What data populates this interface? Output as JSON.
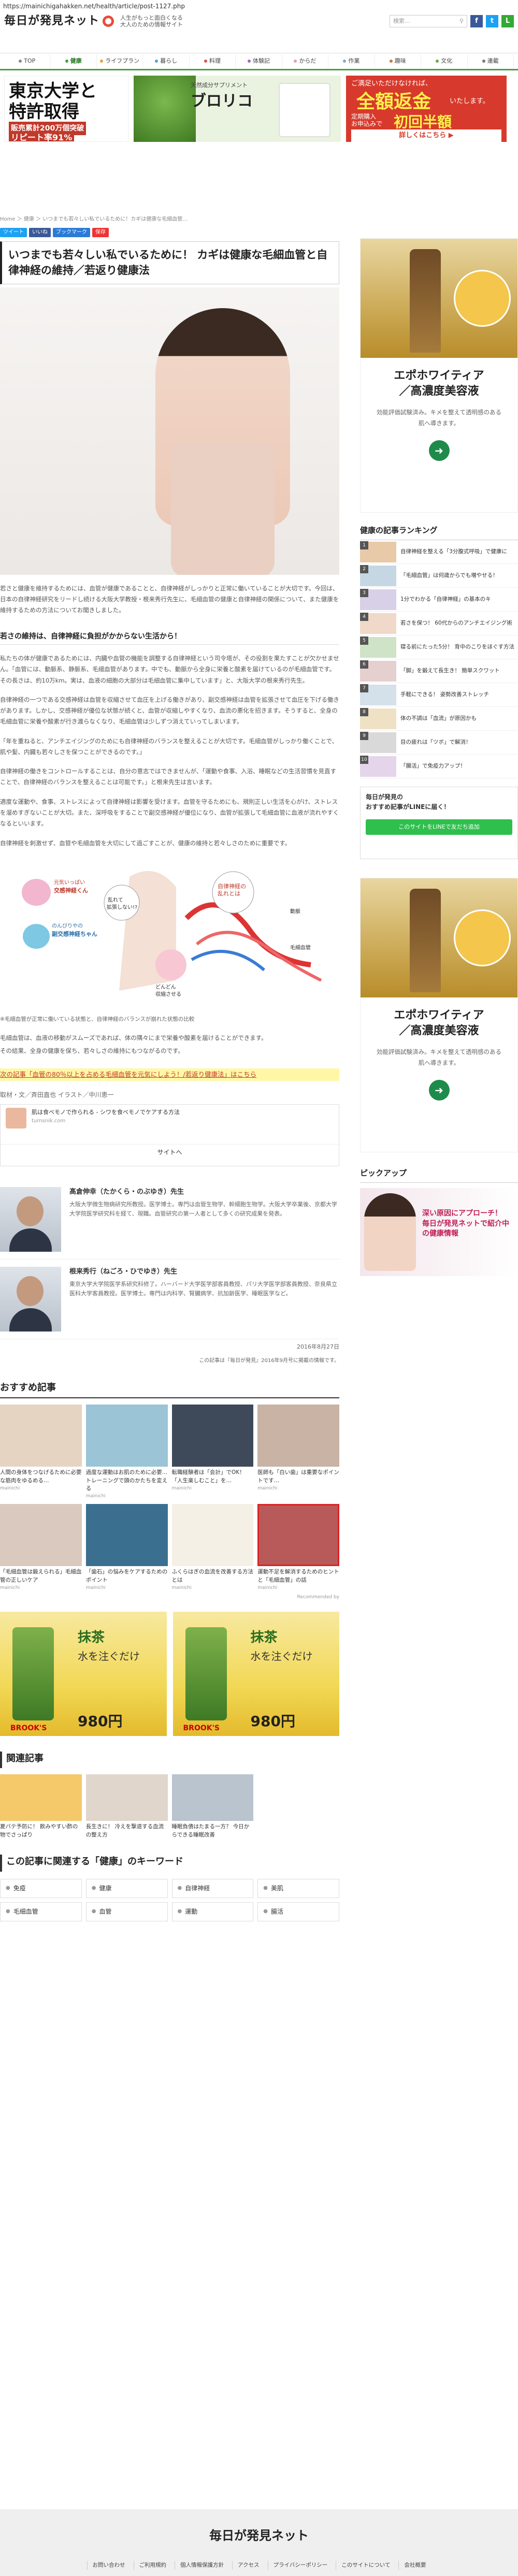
{
  "url": "https://mainichigahakken.net/health/article/post-1127.php",
  "logo": {
    "name": "毎日が発見ネット",
    "tagline_1": "人生がもっと面白くなる",
    "tagline_2": "大人のための情報サイト"
  },
  "search": {
    "placeholder": "検索..."
  },
  "nav": [
    {
      "label": "TOP",
      "color": "#888"
    },
    {
      "label": "健康",
      "color": "#4a9f45"
    },
    {
      "label": "ライフプラン",
      "color": "#e7a23a"
    },
    {
      "label": "暮らし",
      "color": "#4aa3d6"
    },
    {
      "label": "料理",
      "color": "#d9534f"
    },
    {
      "label": "体験記",
      "color": "#9b6db5"
    },
    {
      "label": "からだ",
      "color": "#e4a0b0"
    },
    {
      "label": "作業",
      "color": "#8aa6c1"
    },
    {
      "label": "趣味",
      "color": "#c07b3a"
    },
    {
      "label": "文化",
      "color": "#6aa84f"
    },
    {
      "label": "連載",
      "color": "#777"
    }
  ],
  "banner1": {
    "line1": "東京大学と",
    "line2": "特許取得",
    "line3": "販売累計200万個突破",
    "line4": "リピート率91%"
  },
  "banner2": {
    "small": "天然成分サプリメント",
    "brand": "ブロリコ"
  },
  "banner3": {
    "small": "ご満足いただけなければ、",
    "big": "全額返金",
    "sub": "いたします。",
    "sub2": "定期購入",
    "sub3": "お申込みで",
    "sub4": "初回半額",
    "cta": "詳しくはこちら ▶"
  },
  "breadcrumb": "Home ＞ 健康 ＞ いつまでも若々しい私でいるために！カギは健康な毛細血管…",
  "share": [
    "ツイート",
    "いいね",
    "ブックマーク",
    "保存"
  ],
  "article": {
    "title": "いつまでも若々しい私でいるために！ カギは健康な毛細血管と自律神経の維持／若返り健康法",
    "p1": "若さと健康を維持するためには、血管が健康であることと、自律神経がしっかりと正常に働いていることが大切です。今回は、日本の自律神経研究をリードし続ける大阪大学教授・根来秀行先生に、毛細血管の健康と自律神経の関係について、また健康を維持するための方法についてお聞きしました。",
    "h2": "若さの維持は、自律神経に負担がかからない生活から！",
    "p2": "私たちの体が健康であるためには、内臓や血管の機能を調整する自律神経という司令塔が、その役割を果たすことが欠かせません。「血管には、動脈系、静脈系、毛細血管があります。中でも、動脈から全身に栄養と酸素を届けているのが毛細血管です。その長さは、約10万km。実は、血液の細胞の大部分は毛細血管に集中しています」と、大阪大学の根来秀行先生。",
    "p3": "自律神経の一つである交感神経は血管を収縮させて血圧を上げる働きがあり、副交感神経は血管を拡張させて血圧を下げる働きがあります。しかし、交感神経が優位な状態が続くと、血管が収縮しやすくなり、血流の悪化を招きます。そうすると、全身の毛細血管に栄養や酸素が行き渡らなくなり、毛細血管は少しずつ消えていってしまいます。",
    "p4": "「年を重ねると、アンチエイジングのためにも自律神経のバランスを整えることが大切です。毛細血管がしっかり働くことで、肌や髪、内臓も若々しさを保つことができるのです。」",
    "p5": "自律神経の働きをコントロールすることは、自分の意志ではできませんが、「運動や食事、入浴、睡眠などの生活習慣を見直すことで、自律神経のバランスを整えることは可能です。」と根来先生は言います。",
    "p6": "適度な運動や、食事、ストレスによって自律神経は影響を受けます。血管を守るためにも、規則正しい生活を心がけ、ストレスを溜めすぎないことが大切。また、深呼吸をすることで副交感神経が優位になり、血管が拡張して毛細血管に血液が流れやすくなるといいます。",
    "p7": "自律神経を刺激せず、血管や毛細血管を大切にして過ごすことが、健康の維持と若々しさのために重要です。",
    "caption1": "※毛細血管が正常に働いている状態と、自律神経のバランスが崩れた状態の比較",
    "p8": "毛細血管は、血液の移動がスムーズであれば、体の隅々にまで栄養や酸素を届けることができます。",
    "p9": "その結果、全身の健康を保ち、若々しさの維持にもつながるのです。",
    "yellow_link": "次の記事「血管の80％以上を占める毛細血管を元気にしよう！/若返り健康法」はこちら",
    "credit": "取材・文／斉田直也 イラスト／中川恵一"
  },
  "figure": {
    "label1": "元気いっぱい",
    "label2": "交感神経くん",
    "label3": "のんびりやの",
    "label4": "副交感神経ちゃん",
    "label5": "自律神経の",
    "label6": "乱れとは",
    "label7": "乱れて",
    "label8": "拡張しない!?",
    "label9": "動脈",
    "label10": "毛細血管",
    "label11": "どんどん",
    "label12": "収縮させる"
  },
  "inline_ad": {
    "title": "肌は食べモノで作られる - シワを食べモノでケアする方法",
    "source": "turnsnik.com",
    "cta": "サイトへ"
  },
  "doctors": [
    {
      "name": "髙倉伸幸（たかくら・のぶゆき）先生",
      "desc": "大阪大学微生物病研究所教授。医学博士。専門は血管生物学、幹細胞生物学。大阪大学卒業後、京都大学大学院医学研究科を経て、現職。血管研究の第一人者として多くの研究成果を発表。"
    },
    {
      "name": "根来秀行（ねごろ・ひでゆき）先生",
      "desc": "東京大学大学院医学系研究科修了。ハーバード大学医学部客員教授、パリ大学医学部客員教授、奈良県立医科大学客員教授。医学博士。専門は内科学、腎臓病学、抗加齢医学、睡眠医学など。"
    }
  ],
  "date": "2016年8月27日",
  "source_note": "この記事は『毎日が発見』2016年9月号に掲載の情報です。",
  "recommend": {
    "heading": "おすすめ記事",
    "cards": [
      {
        "cap": "人間の身体をつなげるために必要な筋肉をゆるめる…",
        "src": "mainichi"
      },
      {
        "cap": "過度な運動はお肌のために必要…トレーニングで頭のかたちを変える",
        "src": "mainichi"
      },
      {
        "cap": "転職経験者は「会計」でOK！ 「人生楽しむこと」を…",
        "src": "mainichi"
      },
      {
        "cap": "医師も「白い歯」は重要なポイントです…",
        "src": "mainichi"
      },
      {
        "cap": "「毛細血管は鍛えられる」毛細血管の正しいケア",
        "src": "mainichi"
      },
      {
        "cap": "「歯石」の悩みをケアするためのポイント",
        "src": "mainichi"
      },
      {
        "cap": "ふくらはぎの血流を改善する方法とは",
        "src": "mainichi"
      },
      {
        "cap": "運動不足を解消するためのヒントと「毛細血管」の話",
        "src": "mainichi"
      }
    ],
    "powered": "Recommended by"
  },
  "bottom_ad": {
    "text1": "抹茶",
    "text2": "水を注ぐだけ",
    "price": "980円",
    "brand": "BROOK'S"
  },
  "related": {
    "heading": "関連記事",
    "cards": [
      {
        "cap": "夏バテ予防に！ 飲みやすい酢の物でさっぱり"
      },
      {
        "cap": "長生きに！ 冷えを撃退する血流の整え方"
      },
      {
        "cap": "睡眠負債はたまる一方？ 今日からできる睡眠改善"
      }
    ]
  },
  "keywords": {
    "heading": "この記事に関連する「健康」のキーワード",
    "items": [
      "免疫",
      "健康",
      "自律神経",
      "美肌",
      "毛細血管",
      "血管",
      "運動",
      "腸活"
    ]
  },
  "footer": {
    "logo": "毎日が発見ネット",
    "links": [
      "お問い合わせ",
      "ご利用規約",
      "個人情報保護方針",
      "アクセス",
      "プライバシーポリシー",
      "このサイトについて",
      "会社概要"
    ]
  },
  "sidebar": {
    "ad1": {
      "title": "エポホワイティア\n／高濃度美容液",
      "sub": "効能評価試験済み。キメを整えて透明感のある\n肌へ導きます。"
    },
    "ranking_heading": "健康の記事ランキング",
    "ranking": [
      "自律神経を整える「3分腹式呼吸」で健康に",
      "「毛細血管」は何歳からでも増やせる！",
      "1分でわかる「自律神経」の基本のキ",
      "若さを保つ！ 60代からのアンチエイジング術",
      "寝る前にたった5分！ 背中のこりをほぐす方法",
      "「脚」を鍛えて長生き！ 簡単スクワット",
      "手軽にできる！ 姿勢改善ストレッチ",
      "体の不調は「血流」が原因かも",
      "目の疲れは「ツボ」で解消！",
      "「腸活」で免疫力アップ！"
    ],
    "line_title": "毎日が発見の\nおすすめ記事がLINEに届く！",
    "line_btn": "このサイトをLINEで友だち追加",
    "ad2": {
      "title": "エポホワイティア\n／高濃度美容液",
      "sub": "効能評価試験済み。キメを整えて透明感のある\n肌へ導きます。"
    },
    "pickup_heading": "ピックアップ",
    "pickup_text": "深い原因にアプローチ！ 毎日が発見ネットで紹介中の健康情報"
  }
}
